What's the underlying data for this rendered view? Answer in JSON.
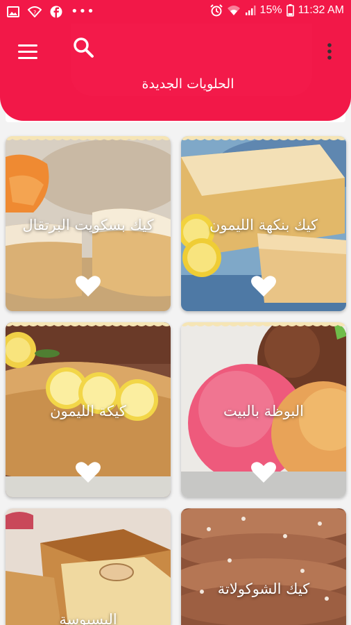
{
  "status_bar": {
    "icons_left": [
      "gallery-icon",
      "wifi-question-icon",
      "facebook-icon",
      "more-dots-icon"
    ],
    "more_dots": "•••",
    "icons_right": [
      "alarm-icon",
      "wifi-icon",
      "signal-icon",
      "battery-icon"
    ],
    "battery": "15%",
    "time": "11:32 AM"
  },
  "header": {
    "title": "الحلويات الجديدة",
    "menu_icon": "hamburger-icon",
    "search_icon": "search-icon",
    "overflow_icon": "more-vert-icon"
  },
  "colors": {
    "primary": "#f21848",
    "heart": "#ffffff",
    "background": "#f3f3f3"
  },
  "recipes": [
    {
      "title": "كيك بنكهة الليمون"
    },
    {
      "title": "كيك بسكويت البرتقال"
    },
    {
      "title": "البوظة بالبيت"
    },
    {
      "title": "كيكة الليمون"
    },
    {
      "title": "كيك الشوكولاتة"
    },
    {
      "title": "البسبوسة"
    }
  ]
}
